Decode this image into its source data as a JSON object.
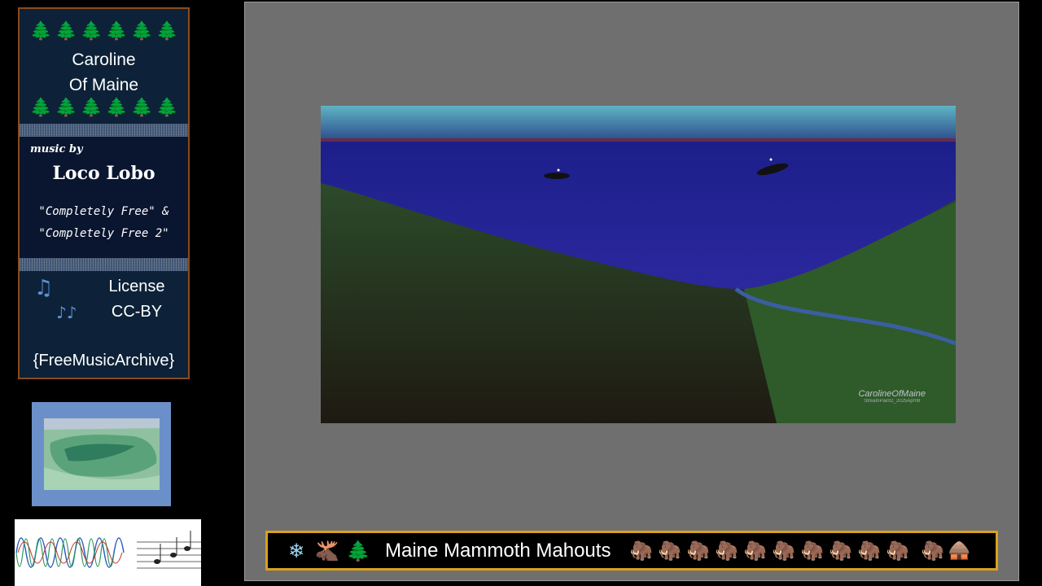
{
  "panel": {
    "trees_top": [
      "🌲",
      "🌲",
      "🌲",
      "🌲",
      "🌲",
      "🌲"
    ],
    "trees_bottom": [
      "🌲",
      "🌲",
      "🌲",
      "🌲",
      "🌲",
      "🌲"
    ],
    "title_line1": "Caroline",
    "title_line2": "Of Maine",
    "music_by": "music by",
    "artist": "Loco Lobo",
    "album_line1": "\"Completely Free\" &",
    "album_line2": "\"Completely Free 2\"",
    "note_icon_1": "♫",
    "note_icon_2": "♪♪",
    "license_line1": "License",
    "license_line2": "CC-BY",
    "source": "{FreeMusicArchive}"
  },
  "painting": {
    "watermark_line1": "CarolineOfMaine",
    "watermark_line2": "StreamPaint2_2025Apr08"
  },
  "banner": {
    "icons_left": [
      {
        "name": "snowflake-icon",
        "glyph": "❄"
      },
      {
        "name": "moose-icon",
        "glyph": "🫎"
      },
      {
        "name": "pine-tree-icon",
        "glyph": "🌲"
      }
    ],
    "title": "Maine Mammoth Mahouts",
    "mammoths": [
      "🦣",
      "🦣",
      "🦣",
      "🦣",
      "🦣",
      "🦣",
      "🦣",
      "🦣",
      "🦣",
      "🦣",
      "🦣"
    ],
    "end_icon": "🛖"
  },
  "colors": {
    "panel_border": "#8a4a1c",
    "banner_border": "#d8a21a",
    "stage_bg": "#6f6f6f"
  }
}
